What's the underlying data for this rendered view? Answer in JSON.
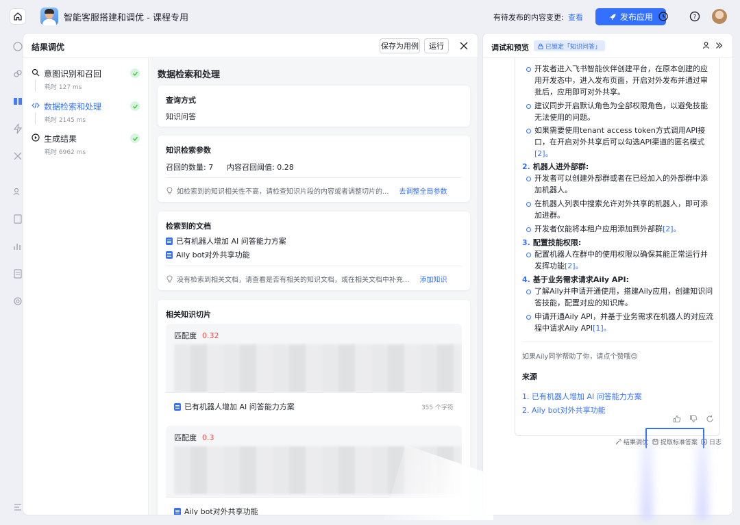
{
  "app": {
    "title": "智能客服搭建和调优 - 课程专用",
    "pending_label": "有待发布的内容变更:",
    "pending_link": "查看",
    "publish_label": "发布应用"
  },
  "result_panel": {
    "title": "结果调优",
    "save_case_label": "保存为用例",
    "run_label": "运行",
    "steps": [
      {
        "label": "意图识别和召回",
        "time": "耗时 127 ms"
      },
      {
        "label": "数据检索和处理",
        "time": "耗时 2145 ms"
      },
      {
        "label": "生成结果",
        "time": "耗时 6962 ms"
      }
    ],
    "detail_title": "数据检索和处理",
    "query": {
      "title": "查询方式",
      "value": "知识问答"
    },
    "params": {
      "title": "知识检索参数",
      "recall_count": "召回的数量:  7",
      "threshold": "内容召回阈值:  0.28",
      "hint": "如检索到的知识相关性不高，请检查知识片段的内容或者调整切片的...",
      "hint_link": "去调整全局参数"
    },
    "docs": {
      "title": "检索到的文档",
      "items": [
        "已有机器人增加 AI 问答能力方案",
        "Aily bot对外共享功能"
      ],
      "hint": "没有检索到相关文档，请查看是否有相关的知识文档，或在相关文档中补充...",
      "hint_link": "添加知识"
    },
    "chunks": {
      "title": "相关知识切片",
      "match_label": "匹配度",
      "items": [
        {
          "score": "0.32",
          "doc": "已有机器人增加 AI 问答能力方案",
          "chars": "355 个字符"
        },
        {
          "score": "0.3",
          "doc": "Aily bot对外共享功能",
          "chars": ""
        }
      ]
    }
  },
  "preview": {
    "title": "调试和预览",
    "lock_badge": "已锁定「知识问答」",
    "section1_bullets": [
      {
        "text": "开发者进入飞书智能伙伴创建平台，在原本创建的应用开发态中，进入发布页面，开启对外发布并通过审批后，应用即可对外共享。",
        "ref": ""
      },
      {
        "text": "建议同步开启默认角色为全部权限角色，以避免技能无法使用的问题。",
        "ref": ""
      },
      {
        "text": "如果需要使用tenant access token方式调用API接口，在开启对外共享后可以勾选API渠道的匿名模式",
        "ref": "[2]。"
      }
    ],
    "section2": {
      "num": "2.",
      "title": "机器人进外部群:",
      "bullets": [
        {
          "text": "开发者可以创建外部群或者在已经加入的外部群中添加机器人。",
          "ref": ""
        },
        {
          "text": "在机器人列表中搜索允许对外共享的机器人，即可添加进群。",
          "ref": ""
        },
        {
          "text": "开发者仅能将本租户应用添加到外部群",
          "ref": "[2]。"
        }
      ]
    },
    "section3": {
      "num": "3.",
      "title": "配置技能权限:",
      "bullets": [
        {
          "text": "配置机器人在群中的使用权限以确保其能正常运行并发挥功能",
          "ref": "[2]。"
        }
      ]
    },
    "section4": {
      "num": "4.",
      "title": "基于业务需求请求Aily API:",
      "bullets": [
        {
          "text": "了解Aily并申请开通使用，搭建Aily应用，创建知识问答技能，配置对应的知识库。",
          "ref": ""
        },
        {
          "text": "申请开通Aily API，并基于业务需求在机器人的对应流程中请求Aily API",
          "ref": "[1]。"
        }
      ]
    },
    "feedback": "如果Aily同学帮助了你，请点个赞哦😊",
    "sources_title": "来源",
    "sources": [
      "1.  已有机器人增加 AI 问答能力方案",
      "2.  Aily bot对外共享功能"
    ],
    "footer": {
      "result_tune": "结果调优",
      "extract": "提取标准答案",
      "log": "日志"
    }
  },
  "colors": {
    "accent": "#3370ff",
    "success": "#34c724",
    "score": "#f54a45"
  }
}
